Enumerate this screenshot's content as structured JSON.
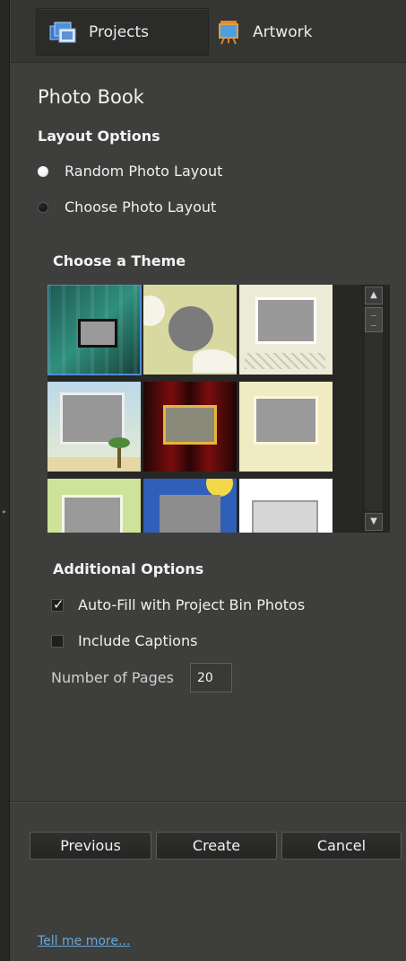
{
  "tabs": {
    "projects": {
      "label": "Projects",
      "icon": "projects-icon"
    },
    "artwork": {
      "label": "Artwork",
      "icon": "artwork-icon"
    }
  },
  "panel": {
    "title": "Photo Book",
    "layout": {
      "heading": "Layout Options",
      "options": [
        {
          "label": "Random Photo Layout",
          "selected": true
        },
        {
          "label": "Choose Photo Layout",
          "selected": false
        }
      ]
    },
    "theme": {
      "heading": "Choose a Theme",
      "selected_index": 0
    },
    "additional": {
      "heading": "Additional Options",
      "autofill": {
        "label": "Auto-Fill with Project Bin Photos",
        "checked": true
      },
      "captions": {
        "label": "Include Captions",
        "checked": false
      },
      "pages": {
        "label": "Number of Pages",
        "value": "20"
      }
    },
    "buttons": {
      "previous": "Previous",
      "create": "Create",
      "cancel": "Cancel"
    },
    "link": "Tell me more..."
  },
  "colors": {
    "panel_bg": "#3e3e3c",
    "selection_outline": "#4a8bd0",
    "link": "#6aa6d8"
  }
}
